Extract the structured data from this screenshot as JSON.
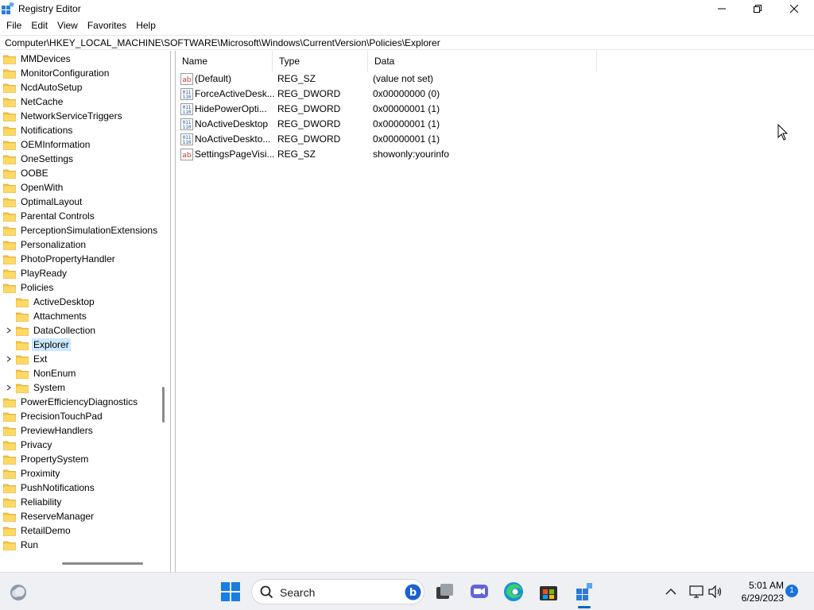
{
  "window": {
    "title": "Registry Editor",
    "controls": [
      "minimize",
      "maximize",
      "close"
    ]
  },
  "menu": [
    "File",
    "Edit",
    "View",
    "Favorites",
    "Help"
  ],
  "address": "Computer\\HKEY_LOCAL_MACHINE\\SOFTWARE\\Microsoft\\Windows\\CurrentVersion\\Policies\\Explorer",
  "tree": {
    "items": [
      {
        "label": "MMDevices",
        "level": 0,
        "expandable": false
      },
      {
        "label": "MonitorConfiguration",
        "level": 0,
        "expandable": false
      },
      {
        "label": "NcdAutoSetup",
        "level": 0,
        "expandable": false
      },
      {
        "label": "NetCache",
        "level": 0,
        "expandable": false
      },
      {
        "label": "NetworkServiceTriggers",
        "level": 0,
        "expandable": false
      },
      {
        "label": "Notifications",
        "level": 0,
        "expandable": false
      },
      {
        "label": "OEMInformation",
        "level": 0,
        "expandable": false
      },
      {
        "label": "OneSettings",
        "level": 0,
        "expandable": false
      },
      {
        "label": "OOBE",
        "level": 0,
        "expandable": false
      },
      {
        "label": "OpenWith",
        "level": 0,
        "expandable": false
      },
      {
        "label": "OptimalLayout",
        "level": 0,
        "expandable": false
      },
      {
        "label": "Parental Controls",
        "level": 0,
        "expandable": false
      },
      {
        "label": "PerceptionSimulationExtensions",
        "level": 0,
        "expandable": false
      },
      {
        "label": "Personalization",
        "level": 0,
        "expandable": false
      },
      {
        "label": "PhotoPropertyHandler",
        "level": 0,
        "expandable": false
      },
      {
        "label": "PlayReady",
        "level": 0,
        "expandable": false
      },
      {
        "label": "Policies",
        "level": 0,
        "expandable": false
      },
      {
        "label": "ActiveDesktop",
        "level": 1,
        "expandable": false
      },
      {
        "label": "Attachments",
        "level": 1,
        "expandable": false
      },
      {
        "label": "DataCollection",
        "level": 1,
        "expandable": true
      },
      {
        "label": "Explorer",
        "level": 1,
        "expandable": false,
        "selected": true
      },
      {
        "label": "Ext",
        "level": 1,
        "expandable": true
      },
      {
        "label": "NonEnum",
        "level": 1,
        "expandable": false
      },
      {
        "label": "System",
        "level": 1,
        "expandable": true
      },
      {
        "label": "PowerEfficiencyDiagnostics",
        "level": 0,
        "expandable": false
      },
      {
        "label": "PrecisionTouchPad",
        "level": 0,
        "expandable": false
      },
      {
        "label": "PreviewHandlers",
        "level": 0,
        "expandable": false
      },
      {
        "label": "Privacy",
        "level": 0,
        "expandable": false
      },
      {
        "label": "PropertySystem",
        "level": 0,
        "expandable": false
      },
      {
        "label": "Proximity",
        "level": 0,
        "expandable": false
      },
      {
        "label": "PushNotifications",
        "level": 0,
        "expandable": false
      },
      {
        "label": "Reliability",
        "level": 0,
        "expandable": false
      },
      {
        "label": "ReserveManager",
        "level": 0,
        "expandable": false
      },
      {
        "label": "RetailDemo",
        "level": 0,
        "expandable": false
      },
      {
        "label": "Run",
        "level": 0,
        "expandable": false
      }
    ]
  },
  "list": {
    "columns": [
      "Name",
      "Type",
      "Data"
    ],
    "rows": [
      {
        "name": "(Default)",
        "type": "REG_SZ",
        "data": "(value not set)",
        "icon": "string-value-icon"
      },
      {
        "name": "ForceActiveDesk...",
        "type": "REG_DWORD",
        "data": "0x00000000 (0)",
        "icon": "dword-value-icon"
      },
      {
        "name": "HidePowerOpti...",
        "type": "REG_DWORD",
        "data": "0x00000001 (1)",
        "icon": "dword-value-icon"
      },
      {
        "name": "NoActiveDesktop",
        "type": "REG_DWORD",
        "data": "0x00000001 (1)",
        "icon": "dword-value-icon"
      },
      {
        "name": "NoActiveDeskto...",
        "type": "REG_DWORD",
        "data": "0x00000001 (1)",
        "icon": "dword-value-icon"
      },
      {
        "name": "SettingsPageVisi...",
        "type": "REG_SZ",
        "data": "showonly:yourinfo",
        "icon": "string-value-icon"
      }
    ]
  },
  "taskbar": {
    "search_label": "Search",
    "time": "5:01 AM",
    "date": "6/29/2023",
    "notification_count": "1",
    "accent": "#0067c0"
  }
}
